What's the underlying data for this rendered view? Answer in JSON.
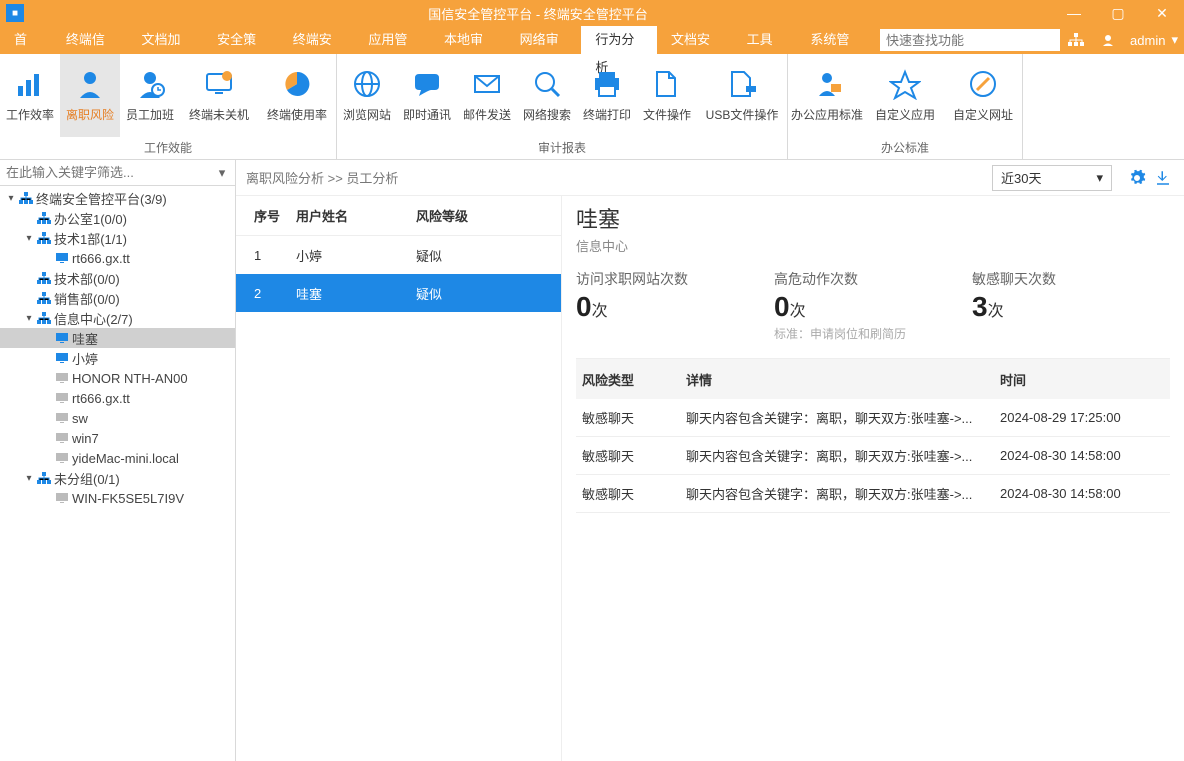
{
  "titlebar": {
    "title": "国信安全管控平台 - 终端安全管控平台"
  },
  "menubar": {
    "items": [
      "首页",
      "终端信息",
      "文档加密",
      "安全策略",
      "终端安全",
      "应用管理",
      "本地审计",
      "网络审计",
      "行为分析",
      "文档安全",
      "工具箱",
      "系统管理"
    ],
    "active": 8,
    "search_placeholder": "快速查找功能",
    "user": "admin"
  },
  "ribbon": {
    "groups": [
      {
        "label": "工作效能",
        "items": [
          {
            "label": "工作效率"
          },
          {
            "label": "离职风险"
          },
          {
            "label": "员工加班"
          },
          {
            "label": "终端未关机"
          },
          {
            "label": "终端使用率"
          }
        ],
        "active": 1
      },
      {
        "label": "审计报表",
        "items": [
          {
            "label": "浏览网站"
          },
          {
            "label": "即时通讯"
          },
          {
            "label": "邮件发送"
          },
          {
            "label": "网络搜索"
          },
          {
            "label": "终端打印"
          },
          {
            "label": "文件操作"
          },
          {
            "label": "USB文件操作"
          }
        ]
      },
      {
        "label": "办公标准",
        "items": [
          {
            "label": "办公应用标准"
          },
          {
            "label": "自定义应用"
          },
          {
            "label": "自定义网址"
          }
        ]
      }
    ]
  },
  "sidebar": {
    "filter_placeholder": "在此输入关键字筛选...",
    "tree": [
      {
        "indent": 0,
        "tw": "▾",
        "icon": "org",
        "label": "终端安全管控平台(3/9)"
      },
      {
        "indent": 1,
        "tw": "",
        "icon": "org",
        "label": "办公室1(0/0)"
      },
      {
        "indent": 1,
        "tw": "▾",
        "icon": "org",
        "label": "技术1部(1/1)"
      },
      {
        "indent": 2,
        "tw": "",
        "icon": "pc",
        "label": "rt666.gx.tt"
      },
      {
        "indent": 1,
        "tw": "",
        "icon": "org",
        "label": "技术部(0/0)"
      },
      {
        "indent": 1,
        "tw": "",
        "icon": "org",
        "label": "销售部(0/0)"
      },
      {
        "indent": 1,
        "tw": "▾",
        "icon": "org",
        "label": "信息中心(2/7)",
        "selgroup": true
      },
      {
        "indent": 2,
        "tw": "",
        "icon": "pc",
        "label": "哇塞",
        "selected": true
      },
      {
        "indent": 2,
        "tw": "",
        "icon": "pc",
        "label": "小婷"
      },
      {
        "indent": 2,
        "tw": "",
        "icon": "grey",
        "label": "HONOR NTH-AN00"
      },
      {
        "indent": 2,
        "tw": "",
        "icon": "grey",
        "label": "rt666.gx.tt"
      },
      {
        "indent": 2,
        "tw": "",
        "icon": "grey",
        "label": "sw"
      },
      {
        "indent": 2,
        "tw": "",
        "icon": "grey",
        "label": "win7"
      },
      {
        "indent": 2,
        "tw": "",
        "icon": "grey",
        "label": "yideMac-mini.local"
      },
      {
        "indent": 1,
        "tw": "▾",
        "icon": "org",
        "label": "未分组(0/1)"
      },
      {
        "indent": 2,
        "tw": "",
        "icon": "grey",
        "label": "WIN-FK5SE5L7I9V"
      }
    ]
  },
  "main": {
    "breadcrumb": "离职风险分析  >>  员工分析",
    "period": "近30天",
    "list": {
      "headers": [
        "序号",
        "用户姓名",
        "风险等级"
      ],
      "rows": [
        {
          "no": "1",
          "name": "小婷",
          "level": "疑似"
        },
        {
          "no": "2",
          "name": "哇塞",
          "level": "疑似"
        }
      ],
      "selected": 1
    },
    "detail": {
      "name": "哇塞",
      "sub": "信息中心",
      "stats": [
        {
          "title": "访问求职网站次数",
          "val": "0",
          "unit": "次",
          "note": ""
        },
        {
          "title": "高危动作次数",
          "val": "0",
          "unit": "次",
          "note": "标准：申请岗位和刷简历"
        },
        {
          "title": "敏感聊天次数",
          "val": "3",
          "unit": "次",
          "note": ""
        }
      ],
      "risk": {
        "headers": [
          "风险类型",
          "详情",
          "时间"
        ],
        "rows": [
          {
            "type": "敏感聊天",
            "detail": "聊天内容包含关键字：离职，聊天双方:张哇塞->...",
            "time": "2024-08-29 17:25:00"
          },
          {
            "type": "敏感聊天",
            "detail": "聊天内容包含关键字：离职，聊天双方:张哇塞->...",
            "time": "2024-08-30 14:58:00"
          },
          {
            "type": "敏感聊天",
            "detail": "聊天内容包含关键字：离职，聊天双方:张哇塞->...",
            "time": "2024-08-30 14:58:00"
          }
        ]
      }
    }
  }
}
